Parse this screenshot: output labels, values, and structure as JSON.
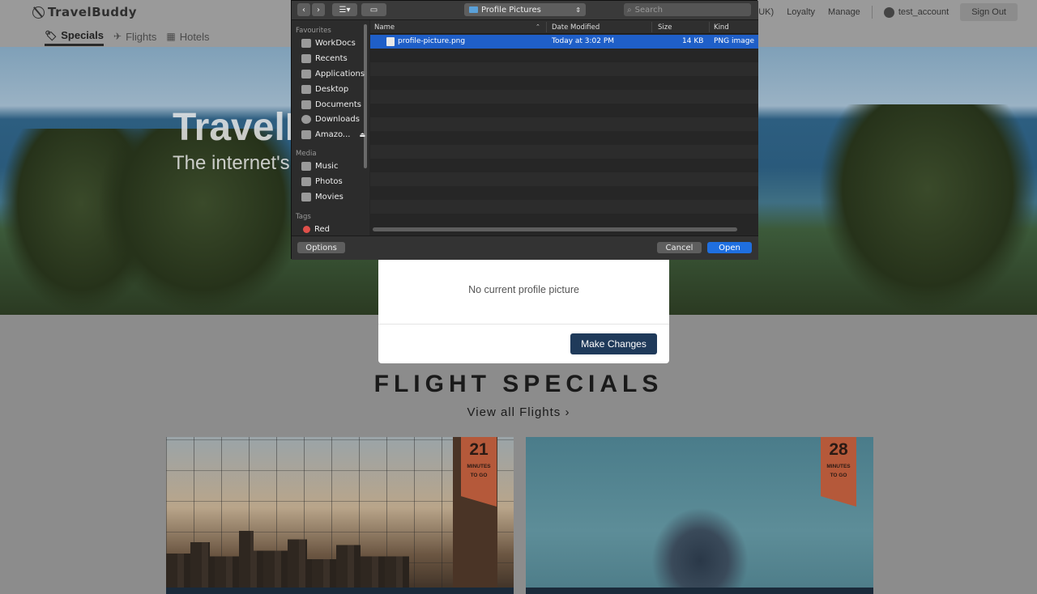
{
  "header": {
    "logo": "TravelBuddy",
    "tabs": [
      {
        "label": "Specials",
        "icon": "tag-icon",
        "active": true
      },
      {
        "label": "Flights",
        "icon": "plane-icon",
        "active": false
      },
      {
        "label": "Hotels",
        "icon": "building-icon",
        "active": false
      }
    ],
    "nav": {
      "region": "UK)",
      "loyalty": "Loyalty",
      "manage": "Manage",
      "account": "test_account",
      "signout": "Sign Out"
    }
  },
  "hero": {
    "title": "TravelB",
    "subtitle": "The internet's"
  },
  "modal": {
    "message": "No current profile picture",
    "button": "Make Changes"
  },
  "specials": {
    "title": "FLIGHT SPECIALS",
    "link": "View all Flights ›",
    "cards": [
      {
        "minutes": "21",
        "line1": "MINUTES",
        "line2": "TO GO"
      },
      {
        "minutes": "28",
        "line1": "MINUTES",
        "line2": "TO GO"
      }
    ]
  },
  "dialog": {
    "location": "Profile Pictures",
    "search_placeholder": "Search",
    "sidebar": {
      "favourites_label": "Favourites",
      "favourites": [
        "WorkDocs",
        "Recents",
        "Applications",
        "Desktop",
        "Documents",
        "Downloads",
        "Amazo..."
      ],
      "media_label": "Media",
      "media": [
        "Music",
        "Photos",
        "Movies"
      ],
      "tags_label": "Tags",
      "tags": [
        "Red"
      ]
    },
    "columns": {
      "name": "Name",
      "date": "Date Modified",
      "size": "Size",
      "kind": "Kind"
    },
    "files": [
      {
        "name": "profile-picture.png",
        "date": "Today at 3:02 PM",
        "size": "14 KB",
        "kind": "PNG image",
        "selected": true
      }
    ],
    "buttons": {
      "options": "Options",
      "cancel": "Cancel",
      "open": "Open"
    }
  },
  "colors": {
    "accent": "#1f3a5a",
    "selection": "#1f5fc8",
    "badge": "#b5593a"
  }
}
